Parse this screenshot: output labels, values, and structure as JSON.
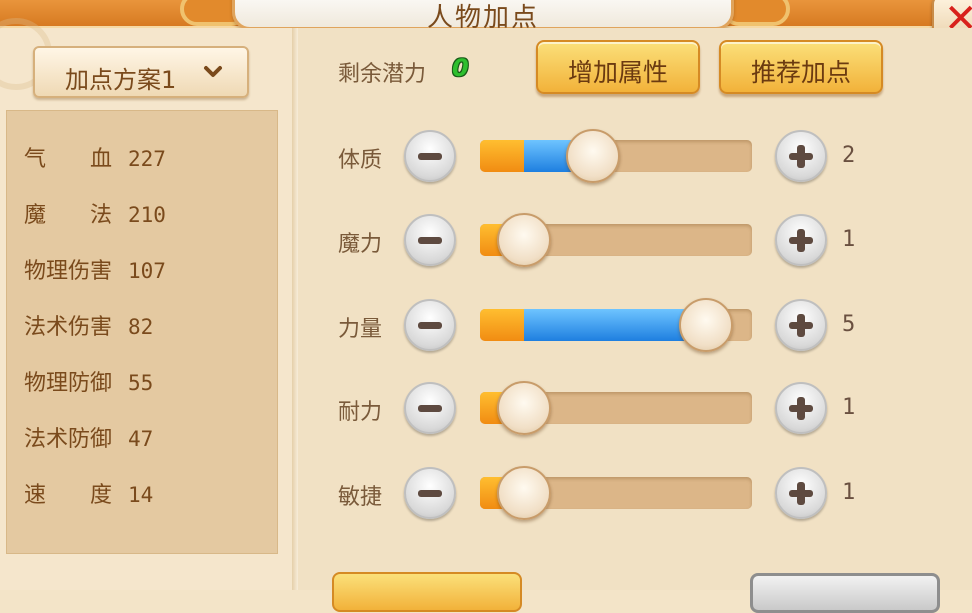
{
  "window": {
    "title": "人物加点",
    "close_icon": "close-x-icon"
  },
  "plan": {
    "selected": "加点方案1",
    "dropdown_icon": "chevron-down-icon"
  },
  "stats": [
    {
      "name": "气　　血",
      "value": "227"
    },
    {
      "name": "魔　　法",
      "value": "210"
    },
    {
      "name": "物理伤害",
      "value": "107"
    },
    {
      "name": "法术伤害",
      "value": "82"
    },
    {
      "name": "物理防御",
      "value": "55"
    },
    {
      "name": "法术防御",
      "value": "47"
    },
    {
      "name": "速　　度",
      "value": "14"
    }
  ],
  "potential": {
    "label": "剩余潜力",
    "value": "0"
  },
  "buttons": {
    "add_attr": "增加属性",
    "recommend": "推荐加点"
  },
  "attributes": [
    {
      "label": "体质",
      "value": "2",
      "fill": 0.38
    },
    {
      "label": "魔力",
      "value": "1",
      "fill": 0.0
    },
    {
      "label": "力量",
      "value": "5",
      "fill": 1.0
    },
    {
      "label": "耐力",
      "value": "1",
      "fill": 0.0
    },
    {
      "label": "敏捷",
      "value": "1",
      "fill": 0.0
    }
  ],
  "colors": {
    "accent_orange": "#e9953c",
    "potential_green": "#2ebf2e",
    "slider_blue": "#1e7fe0",
    "close_red": "#d8211c"
  }
}
